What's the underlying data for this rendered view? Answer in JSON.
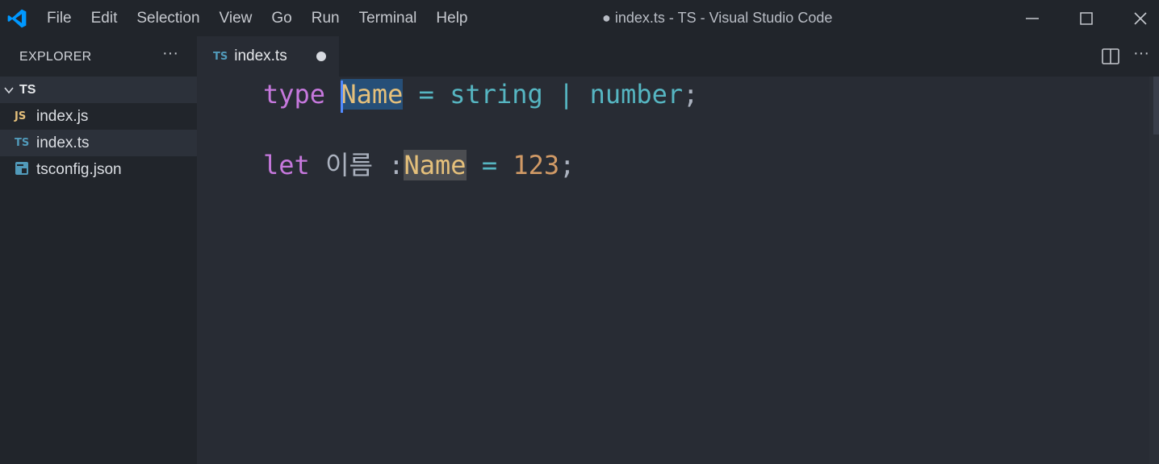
{
  "titlebar": {
    "menu": [
      "File",
      "Edit",
      "Selection",
      "View",
      "Go",
      "Run",
      "Terminal",
      "Help"
    ],
    "window_title": "● index.ts - TS - Visual Studio Code",
    "accent": "#0098ff"
  },
  "sidebar": {
    "title": "EXPLORER",
    "more": "···",
    "folder": "TS",
    "files": [
      {
        "icon": "JS",
        "name": "index.js"
      },
      {
        "icon": "TS",
        "name": "index.ts"
      },
      {
        "icon": "tsconfig-icon",
        "name": "tsconfig.json"
      }
    ]
  },
  "tabs": {
    "active": {
      "icon": "TS",
      "label": "index.ts"
    },
    "more": "···"
  },
  "editor": {
    "line1": {
      "kw": "type",
      "name": "Name",
      "eq": "=",
      "t1": "string",
      "pipe": "|",
      "t2": "number",
      "semi": ";"
    },
    "line2": {
      "kw": "let",
      "ident": "이름",
      "colon": ":",
      "type": "Name",
      "eq": "=",
      "value": "123",
      "semi": ";"
    }
  }
}
